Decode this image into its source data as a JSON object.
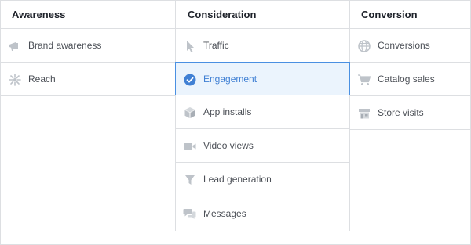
{
  "columns": {
    "awareness": {
      "title": "Awareness",
      "items": [
        {
          "label": "Brand awareness",
          "icon": "megaphone-icon"
        },
        {
          "label": "Reach",
          "icon": "reach-icon"
        }
      ]
    },
    "consideration": {
      "title": "Consideration",
      "items": [
        {
          "label": "Traffic",
          "icon": "cursor-icon"
        },
        {
          "label": "Engagement",
          "icon": "check-circle-icon",
          "selected": true
        },
        {
          "label": "App installs",
          "icon": "box-icon"
        },
        {
          "label": "Video views",
          "icon": "video-camera-icon"
        },
        {
          "label": "Lead generation",
          "icon": "funnel-icon"
        },
        {
          "label": "Messages",
          "icon": "chat-bubbles-icon"
        }
      ]
    },
    "conversion": {
      "title": "Conversion",
      "items": [
        {
          "label": "Conversions",
          "icon": "globe-icon"
        },
        {
          "label": "Catalog sales",
          "icon": "shopping-cart-icon"
        },
        {
          "label": "Store visits",
          "icon": "store-icon"
        }
      ]
    }
  },
  "colors": {
    "icon_gray": "#bec3c9",
    "selected_blue": "#4080d4",
    "selected_bg": "#ebf4fd",
    "border": "#dddfe2"
  }
}
